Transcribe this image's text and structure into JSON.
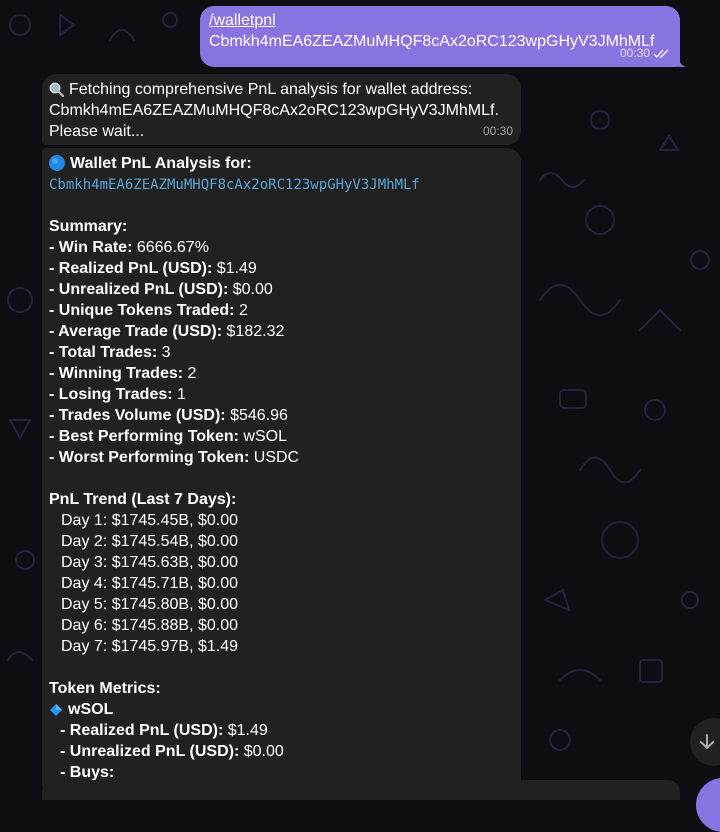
{
  "outgoing": {
    "command": "/walletpnl",
    "address": "Cbmkh4mEA6ZEAZMuMHQF8cAx2oRC123wpGHyV3JMhMLf",
    "time": "00:30"
  },
  "fetching": {
    "line1": "Fetching comprehensive PnL analysis for wallet address:",
    "line2": "Cbmkh4mEA6ZEAZMuMHQF8cAx2oRC123wpGHyV3JMhMLf.",
    "line3": "Please wait...",
    "time": "00:30"
  },
  "analysis": {
    "header": "Wallet PnL Analysis for:",
    "address": "Cbmkh4mEA6ZEAZMuMHQF8cAx2oRC123wpGHyV3JMhMLf",
    "summary_title": "Summary:",
    "summary": [
      {
        "label": "- Win Rate:",
        "value": " 6666.67%"
      },
      {
        "label": "- Realized PnL (USD):",
        "value": " $1.49"
      },
      {
        "label": "- Unrealized PnL (USD):",
        "value": " $0.00"
      },
      {
        "label": "- Unique Tokens Traded:",
        "value": " 2"
      },
      {
        "label": "- Average Trade (USD):",
        "value": " $182.32"
      },
      {
        "label": "- Total Trades:",
        "value": " 3"
      },
      {
        "label": "- Winning Trades:",
        "value": " 2"
      },
      {
        "label": "- Losing Trades:",
        "value": " 1"
      },
      {
        "label": "- Trades Volume (USD):",
        "value": " $546.96"
      },
      {
        "label": "- Best Performing Token:",
        "value": " wSOL"
      },
      {
        "label": "- Worst Performing Token:",
        "value": " USDC"
      }
    ],
    "trend_title": "PnL Trend (Last 7 Days):",
    "trend": [
      "Day 1: $1745.45B, $0.00",
      "Day 2: $1745.54B, $0.00",
      "Day 3: $1745.63B, $0.00",
      "Day 4: $1745.71B, $0.00",
      "Day 5: $1745.80B, $0.00",
      "Day 6: $1745.88B, $0.00",
      "Day 7: $1745.97B, $1.49"
    ],
    "metrics_title": "Token Metrics:",
    "token_name": "wSOL",
    "token_lines": [
      {
        "label": "- Realized PnL (USD):",
        "value": " $1.49"
      },
      {
        "label": "- Unrealized PnL (USD):",
        "value": " $0.00"
      },
      {
        "label": "- Buys:",
        "value": ""
      }
    ]
  },
  "icons": {
    "fetch": "magnifier-icon",
    "header": "blue-circle-icon",
    "token": "blue-diamond-icon",
    "read": "double-check-icon",
    "scroll": "arrow-down-icon"
  },
  "colors": {
    "background": "#0f0c12",
    "outgoing_bubble": "#8774e1",
    "incoming_bubble": "#212121",
    "mono_link": "#58a4d8",
    "pattern": "#2a1f38"
  }
}
